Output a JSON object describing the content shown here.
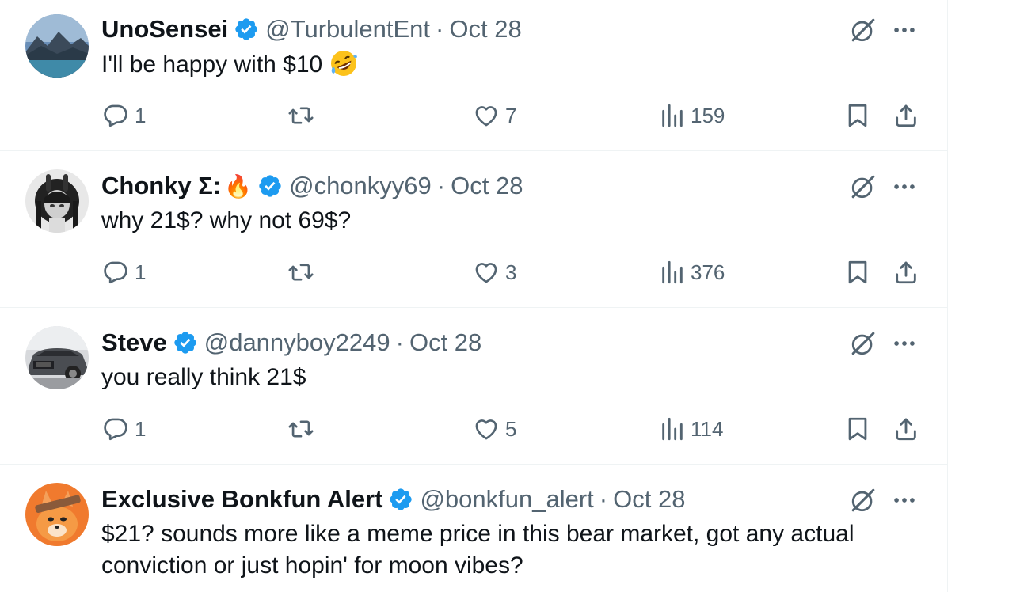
{
  "tweets": [
    {
      "name": "UnoSensei",
      "handle": "@TurbulentEnt",
      "separator": "·",
      "date": "Oct 28",
      "text": "I'll be happy with $10",
      "emoji": "rolling-on-floor-laughing",
      "replies": "1",
      "likes": "7",
      "views": "159",
      "verified": true
    },
    {
      "name": "Chonky Σ:",
      "name_emoji": "🔥",
      "handle": "@chonkyy69",
      "separator": "·",
      "date": "Oct 28",
      "text": "why 21$? why not 69$?",
      "replies": "1",
      "likes": "3",
      "views": "376",
      "verified": true
    },
    {
      "name": "Steve",
      "handle": "@dannyboy2249",
      "separator": "·",
      "date": "Oct 28",
      "text": "you really think 21$",
      "replies": "1",
      "likes": "5",
      "views": "114",
      "verified": true
    },
    {
      "name": "Exclusive Bonkfun Alert",
      "handle": "@bonkfun_alert",
      "separator": "·",
      "date": "Oct 28",
      "text": "$21? sounds more like a meme price in this bear market, got any actual conviction or just hopin' for moon vibes?",
      "verified": true
    }
  ],
  "icons": {
    "reply": "reply-icon",
    "retweet": "retweet-icon",
    "like": "heart-icon",
    "views": "views-icon",
    "bookmark": "bookmark-icon",
    "share": "share-icon",
    "grok": "grok-icon",
    "more": "more-icon",
    "verified": "verified-badge-icon"
  },
  "colors": {
    "text": "#0f1419",
    "secondary": "#536471",
    "verified": "#1d9bf0",
    "divider": "#eff3f4"
  }
}
